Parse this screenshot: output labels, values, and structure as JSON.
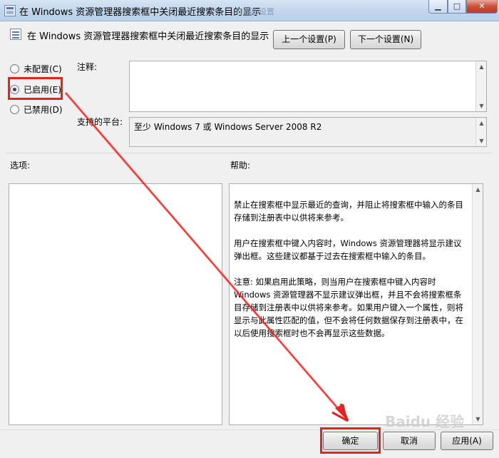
{
  "window": {
    "title": "在 Windows 资源管理器搜索框中关闭最近搜索条目的显示",
    "title_ghost": "与组态设置",
    "minimize_icon": "minimize-icon",
    "maximize_icon": "maximize-icon",
    "close_icon": "close-icon"
  },
  "header": {
    "policy_title": "在 Windows 资源管理器搜索框中关闭最近搜索条目的显示",
    "prev_setting": "上一个设置(P)",
    "next_setting": "下一个设置(N)"
  },
  "state": {
    "options": [
      {
        "label": "未配置(C)",
        "checked": false
      },
      {
        "label": "已启用(E)",
        "checked": true
      },
      {
        "label": "已禁用(D)",
        "checked": false
      }
    ]
  },
  "comment": {
    "label": "注释:",
    "value": ""
  },
  "platform": {
    "label": "支持的平台:",
    "value": "至少 Windows 7 或 Windows Server 2008 R2"
  },
  "options_section": {
    "label": "选项:"
  },
  "help_section": {
    "label": "帮助:",
    "paragraphs": [
      "禁止在搜索框中显示最近的查询，并阻止将搜索框中输入的条目存储到注册表中以供将来参考。",
      "用户在搜索框中键入内容时，Windows 资源管理器将显示建议弹出框。这些建议都基于过去在搜索框中输入的条目。",
      "注意: 如果启用此策略，则当用户在搜索框中键入内容时 Windows 资源管理器不显示建议弹出框，并且不会将搜索框条目存储到注册表中以供将来参考。如果用户键入一个属性，则将显示与此属性匹配的值，但不会将任何数据保存到注册表中，在以后使用搜索框时也不会再显示这些数据。"
    ]
  },
  "footer": {
    "ok": "确定",
    "cancel": "取消",
    "apply": "应用(A)"
  },
  "watermark": "Baidu 经验",
  "colors": {
    "highlight": "#e2241f",
    "titlebar": "#c2d6ec"
  }
}
